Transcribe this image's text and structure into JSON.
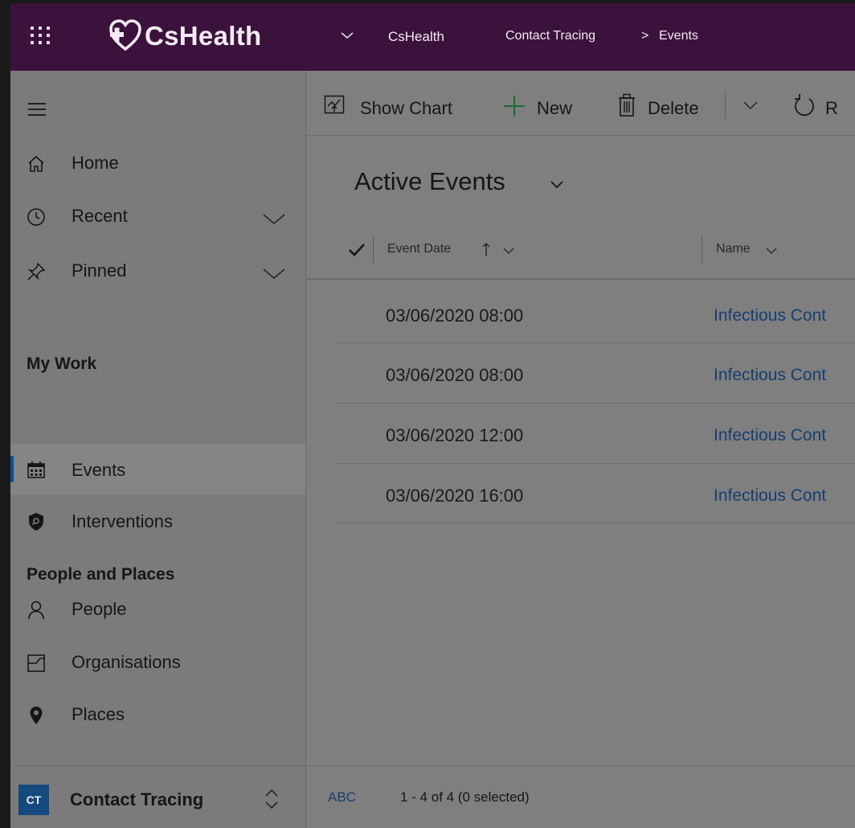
{
  "app": {
    "title": "CsHealth",
    "brand_color": "#3b123c"
  },
  "breadcrumb": {
    "app_switcher": "CsHealth",
    "area": "Contact Tracing",
    "separator": ">",
    "entity": "Events"
  },
  "sidebar": {
    "items": [
      {
        "label": "Home",
        "icon": "home-icon"
      },
      {
        "label": "Recent",
        "icon": "clock-icon"
      },
      {
        "label": "Pinned",
        "icon": "pin-icon"
      }
    ],
    "sections": [
      {
        "title": "My Work",
        "items": [
          {
            "label": "Events",
            "icon": "calendar-icon",
            "selected": true
          },
          {
            "label": "Interventions",
            "icon": "shield-icon"
          }
        ]
      },
      {
        "title": "People and Places",
        "items": [
          {
            "label": "People",
            "icon": "person-icon"
          },
          {
            "label": "Organisations",
            "icon": "organisation-icon"
          },
          {
            "label": "Places",
            "icon": "map-pin-icon"
          }
        ]
      }
    ],
    "area_switcher": {
      "badge": "CT",
      "label": "Contact Tracing"
    }
  },
  "commandbar": {
    "show_chart": "Show Chart",
    "new": "New",
    "delete": "Delete",
    "refresh_partial": "R"
  },
  "view": {
    "title": "Active Events",
    "columns": [
      {
        "label": "Event Date",
        "sort": "ascending"
      },
      {
        "label": "Name"
      }
    ],
    "rows": [
      {
        "date": "03/06/2020 08:00",
        "name": "Infectious Cont"
      },
      {
        "date": "03/06/2020 08:00",
        "name": "Infectious Cont"
      },
      {
        "date": "03/06/2020 12:00",
        "name": "Infectious Cont"
      },
      {
        "date": "03/06/2020 16:00",
        "name": "Infectious Cont"
      }
    ]
  },
  "footer": {
    "jump_bar": "ABC",
    "record_count": "1 - 4 of 4 (0 selected)"
  }
}
